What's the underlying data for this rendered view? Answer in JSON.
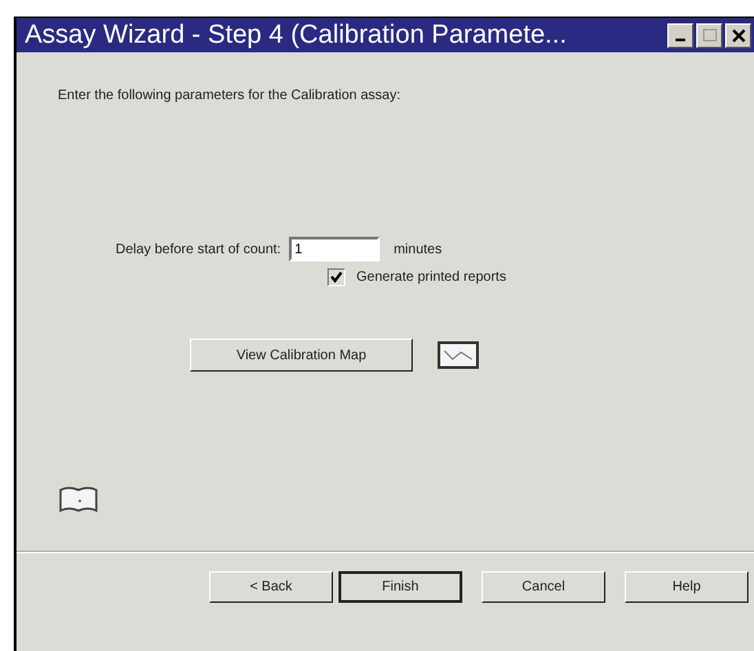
{
  "window": {
    "title": "Assay Wizard - Step 4 (Calibration Paramete..."
  },
  "instruction": "Enter the following parameters for the Calibration assay:",
  "delay": {
    "label": "Delay before start of count:",
    "value": "1",
    "unit": "minutes"
  },
  "report_option": {
    "label": "Generate printed reports",
    "checked": true
  },
  "map_button": "View Calibration Map",
  "buttons": [
    {
      "label": "< Back",
      "default": false
    },
    {
      "label": "Finish",
      "default": true
    },
    {
      "label": "Cancel",
      "default": false
    },
    {
      "label": "Help",
      "default": false
    }
  ]
}
